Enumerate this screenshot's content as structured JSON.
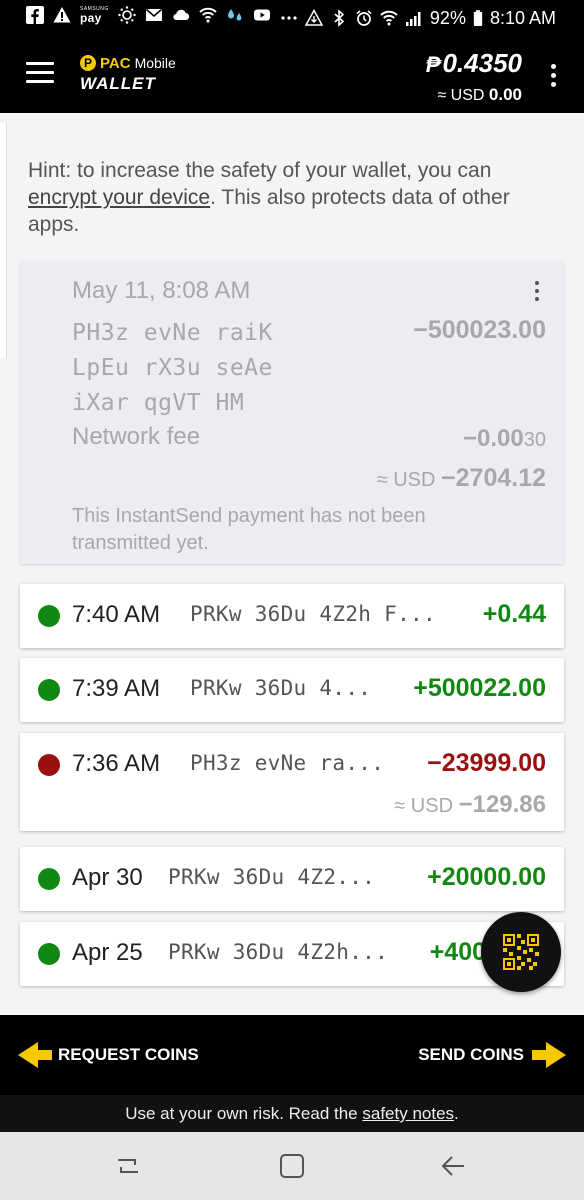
{
  "status_bar": {
    "pay_title": "pay",
    "pay_small": "SAMSUNG",
    "battery": "92%",
    "time": "8:10 AM",
    "icons": [
      "facebook-icon",
      "warning-icon",
      "samsung-pay-icon",
      "sun-dots-icon",
      "mail-icon",
      "cloud-icon",
      "wifi-icon",
      "drops-icon",
      "youtube-icon",
      "more-dots-icon",
      "data-saver-icon",
      "bluetooth-icon",
      "alarm-icon",
      "wifi-icon",
      "signal-icon",
      "battery-icon"
    ]
  },
  "app_bar": {
    "logo_mark": "P",
    "logo_brand": "PAC",
    "logo_sub": "Mobile",
    "logo_wallet": "WALLET",
    "balance_symbol": "₱",
    "balance": "0.4350",
    "usd_prefix": "≈ USD",
    "usd_value": "0.00",
    "accent": "#f6c800"
  },
  "hint": {
    "prefix": "Hint: to increase the safety of your wallet, you can ",
    "link": "encrypt your device",
    "suffix": ". This also protects data of other apps."
  },
  "pending": {
    "date": "May 11, 8:08 AM",
    "address_lines": [
      "PH3z evNe raiK",
      "LpEu rX3u seAe",
      "iXar qgVT HM"
    ],
    "amount": "−500023.00",
    "fee_label": "Network fee",
    "fee_main": "−0.00",
    "fee_small": "30",
    "usd_prefix": "≈ USD",
    "usd_value": "−2704.12",
    "note": "This InstantSend payment has not been transmitted yet."
  },
  "transactions": [
    {
      "time": "7:40 AM",
      "address": "PRKw 36Du 4Z2h F...",
      "amount": "+0.44",
      "status": "received"
    },
    {
      "time": "7:39 AM",
      "address": "PRKw 36Du 4...",
      "amount": "+500022.00",
      "status": "received"
    },
    {
      "time": "7:36 AM",
      "address": "PH3z evNe ra...",
      "amount": "−23999.00",
      "status": "sent",
      "usd_prefix": "≈ USD",
      "usd_value": "−129.86"
    },
    {
      "time": "Apr 30",
      "address": "PRKw 36Du 4Z2...",
      "amount": "+20000.00",
      "status": "received"
    },
    {
      "time": "Apr 25",
      "address": "PRKw 36Du 4Z2h...",
      "amount": "+400",
      "status": "received"
    }
  ],
  "colors": {
    "received": "#118811",
    "sent": "#9a0f0f",
    "accent": "#f6c800"
  },
  "actions": {
    "request": "REQUEST COINS",
    "send": "SEND COINS"
  },
  "footer": {
    "prefix": "Use at your own risk. Read the ",
    "link": "safety notes",
    "suffix": "."
  },
  "nav": [
    "recents-icon",
    "home-icon",
    "back-icon"
  ]
}
